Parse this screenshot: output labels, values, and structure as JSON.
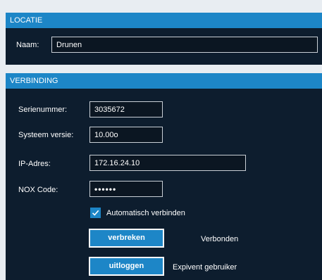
{
  "locatie": {
    "header": "LOCATIE",
    "naam_label": "Naam:",
    "naam_value": "Drunen"
  },
  "verbinding": {
    "header": "VERBINDING",
    "serienummer_label": "Serienummer:",
    "serienummer_value": "3035672",
    "systeem_versie_label": "Systeem versie:",
    "systeem_versie_value": "10.00o",
    "ip_adres_label": "IP-Adres:",
    "ip_adres_value": "172.16.24.10",
    "nox_code_label": "NOX Code:",
    "nox_code_value": "••••••",
    "auto_connect_label": "Automatisch verbinden",
    "auto_connect_checked": true,
    "disconnect_button": "verbreken",
    "status_text": "Verbonden",
    "logout_button": "uitloggen",
    "user_text": "Expivent gebruiker"
  },
  "colors": {
    "accent": "#1d86c7",
    "panel_bg": "#0d1d2e",
    "page_bg": "#e8edf2"
  }
}
